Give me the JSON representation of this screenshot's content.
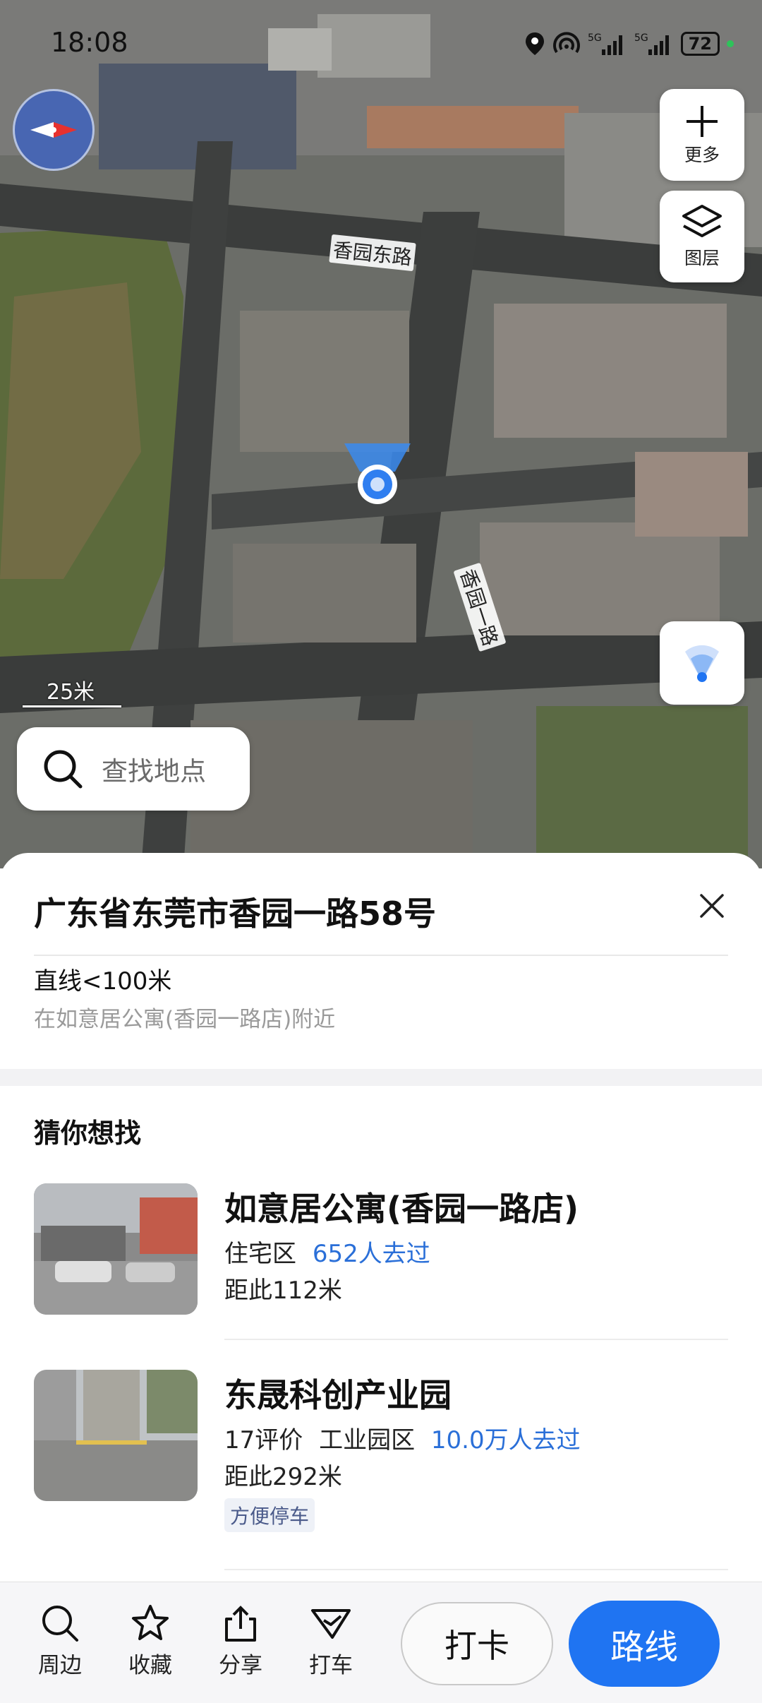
{
  "status_bar": {
    "time": "18:08",
    "battery": "72"
  },
  "map": {
    "more_label": "更多",
    "layers_label": "图层",
    "road_label_1": "香园东路",
    "road_label_2": "香园一路",
    "scale_label": "25米",
    "search_placeholder": "查找地点"
  },
  "place": {
    "address": "广东省东莞市香园一路58号",
    "distance": "直线<100米",
    "nearby": "在如意居公寓(香园一路店)附近"
  },
  "suggestions": {
    "heading": "猜你想找",
    "items": [
      {
        "title": "如意居公寓(香园一路店)",
        "category": "住宅区",
        "reviews": "",
        "visits": "652人去过",
        "distance": "距此112米",
        "tag": ""
      },
      {
        "title": "东晟科创产业园",
        "reviews": "17评价",
        "category": "工业园区",
        "visits": "10.0万人去过",
        "distance": "距此292米",
        "tag": "方便停车"
      }
    ]
  },
  "tabbar": {
    "nearby": "周边",
    "favorite": "收藏",
    "share": "分享",
    "taxi": "打车",
    "checkin": "打卡",
    "route": "路线"
  },
  "colors": {
    "accent": "#1f74f2",
    "link": "#2a6fd8",
    "compass": "#4866b2"
  }
}
